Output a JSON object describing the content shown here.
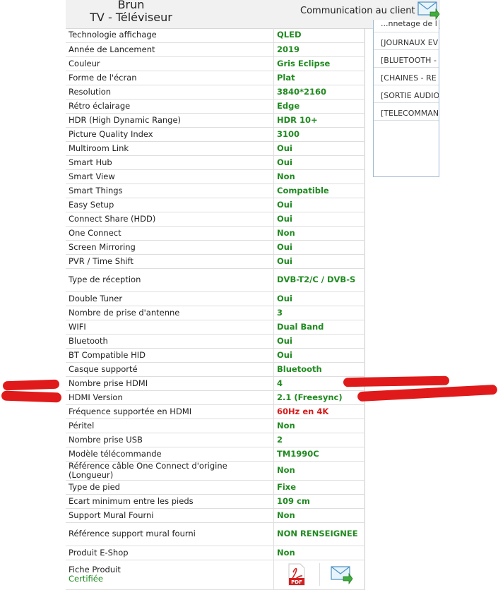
{
  "header": {
    "category_line1": "Brun",
    "category_line2": "TV - Téléviseur",
    "communication_label": "Communication au client"
  },
  "specs": [
    {
      "label": "Technologie affichage",
      "value": "QLED"
    },
    {
      "label": "Année de Lancement",
      "value": "2019"
    },
    {
      "label": "Couleur",
      "value": "Gris Eclipse"
    },
    {
      "label": "Forme de l'écran",
      "value": "Plat"
    },
    {
      "label": "Resolution",
      "value": "3840*2160"
    },
    {
      "label": "Rétro éclairage",
      "value": "Edge"
    },
    {
      "label": "HDR (High Dynamic Range)",
      "value": "HDR 10+"
    },
    {
      "label": "Picture Quality Index",
      "value": "3100"
    },
    {
      "label": "Multiroom Link",
      "value": "Oui"
    },
    {
      "label": "Smart Hub",
      "value": "Oui"
    },
    {
      "label": "Smart View",
      "value": "Non"
    },
    {
      "label": "Smart Things",
      "value": "Compatible"
    },
    {
      "label": "Easy Setup",
      "value": "Oui"
    },
    {
      "label": "Connect Share (HDD)",
      "value": "Oui"
    },
    {
      "label": "One Connect",
      "value": "Non"
    },
    {
      "label": "Screen Mirroring",
      "value": "Oui"
    },
    {
      "label": "PVR / Time Shift",
      "value": "Oui"
    },
    {
      "label": "Type de réception",
      "value": "DVB-T2/C / DVB-S"
    },
    {
      "label": "Double Tuner",
      "value": "Oui"
    },
    {
      "label": "Nombre de prise d'antenne",
      "value": "3"
    },
    {
      "label": "WIFI",
      "value": "Dual Band"
    },
    {
      "label": "Bluetooth",
      "value": "Oui"
    },
    {
      "label": "BT Compatible HID",
      "value": "Oui"
    },
    {
      "label": "Casque supporté",
      "value": "Bluetooth"
    },
    {
      "label": "Nombre prise HDMI",
      "value": "4"
    },
    {
      "label": "HDMI Version",
      "value": "2.1 (Freesync)"
    },
    {
      "label": "Fréquence supportée en HDMI",
      "value": "60Hz en 4K",
      "highlight": "red"
    },
    {
      "label": "Péritel",
      "value": "Non"
    },
    {
      "label": "Nombre prise USB",
      "value": "2"
    },
    {
      "label": "Modèle télécommande",
      "value": "TM1990C"
    },
    {
      "label": "Référence câble One Connect d'origine (Longueur)",
      "value": "Non"
    },
    {
      "label": "Type de pied",
      "value": "Fixe"
    },
    {
      "label": "Ecart minimum entre les pieds",
      "value": "109 cm"
    },
    {
      "label": "Support Mural Fourni",
      "value": "Non"
    },
    {
      "label": "Référence support mural fourni",
      "value": "NON RENSEIGNEE"
    },
    {
      "label": "Produit E-Shop",
      "value": "Non"
    }
  ],
  "fiche": {
    "label": "Fiche Produit",
    "status": "Certifiée",
    "pdf_icon_text": "PDF"
  },
  "side_panel": {
    "items": [
      "...nnetage de l",
      "[JOURNAUX EV le journal d'év téléviseur",
      "[BLUETOOTH - MAC Bluetooth",
      "[CHAINES - RE recherche des",
      "[SORTIE AUDIO la sortie audio",
      "[TELECOMMAN télécommande"
    ]
  },
  "colors": {
    "value_green": "#1f8a1f",
    "value_red": "#d61b1b",
    "annotation_red": "#e01a1a",
    "header_bg": "#f1f1f1"
  }
}
